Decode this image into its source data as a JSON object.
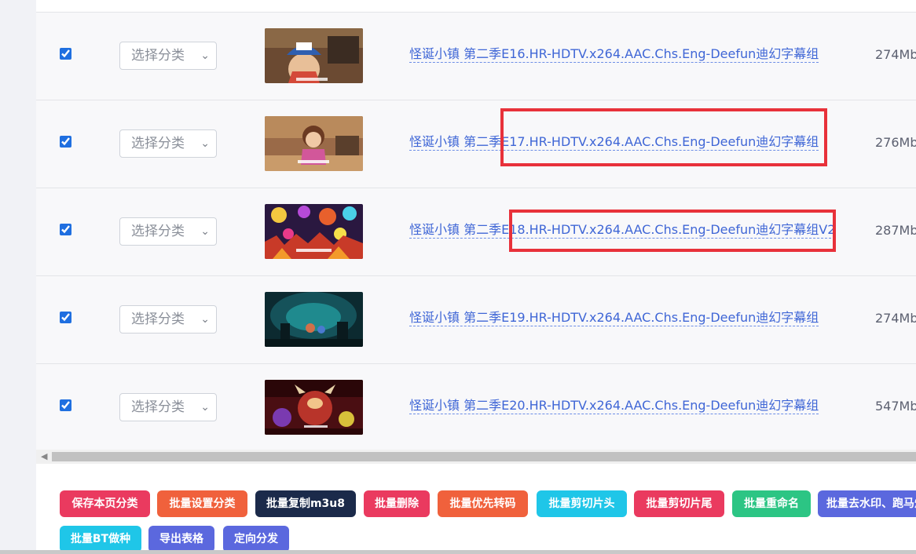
{
  "rows": [
    {
      "title": "怪诞小镇 第二季E16.HR-HDTV.x264.AAC.Chs.Eng-Deefun迪幻字幕组",
      "size": "274Mb",
      "category_placeholder": "选择分类",
      "checked": true,
      "thumb": "thumbnail-boy-cap-icon"
    },
    {
      "title": "怪诞小镇 第二季E17.HR-HDTV.x264.AAC.Chs.Eng-Deefun迪幻字幕组",
      "size": "276Mb",
      "category_placeholder": "选择分类",
      "checked": true,
      "thumb": "thumbnail-girl-sweater-icon"
    },
    {
      "title": "怪诞小镇 第二季E18.HR-HDTV.x264.AAC.Chs.Eng-Deefun迪幻字幕组V2",
      "size": "287Mb",
      "category_placeholder": "选择分类",
      "checked": true,
      "thumb": "thumbnail-chaos-town-icon"
    },
    {
      "title": "怪诞小镇 第二季E19.HR-HDTV.x264.AAC.Chs.Eng-Deefun迪幻字幕组",
      "size": "274Mb",
      "category_placeholder": "选择分类",
      "checked": true,
      "thumb": "thumbnail-dark-cave-icon"
    },
    {
      "title": "怪诞小镇 第二季E20.HR-HDTV.x264.AAC.Chs.Eng-Deefun迪幻字幕组",
      "size": "547Mb",
      "category_placeholder": "选择分类",
      "checked": true,
      "thumb": "thumbnail-monster-fire-icon"
    }
  ],
  "buttons": [
    {
      "label": "保存本页分类",
      "color": "#ea3a5f"
    },
    {
      "label": "批量设置分类",
      "color": "#f0613c"
    },
    {
      "label": "批量复制m3u8",
      "color": "#1b2a4a"
    },
    {
      "label": "批量删除",
      "color": "#ea3a5f"
    },
    {
      "label": "批量优先转码",
      "color": "#f0613c"
    },
    {
      "label": "批量剪切片头",
      "color": "#1fc6e8"
    },
    {
      "label": "批量剪切片尾",
      "color": "#ea3a5f"
    },
    {
      "label": "批量重命名",
      "color": "#2cc584"
    },
    {
      "label": "批量去水印、跑马灯",
      "color": "#5b68de"
    },
    {
      "label": "批量BT做种",
      "color": "#1fc6e8"
    },
    {
      "label": "导出表格",
      "color": "#5b68de"
    },
    {
      "label": "定向分发",
      "color": "#5b68de"
    }
  ],
  "colors": {
    "highlight": "#e8313a",
    "link": "#3f66d6"
  }
}
